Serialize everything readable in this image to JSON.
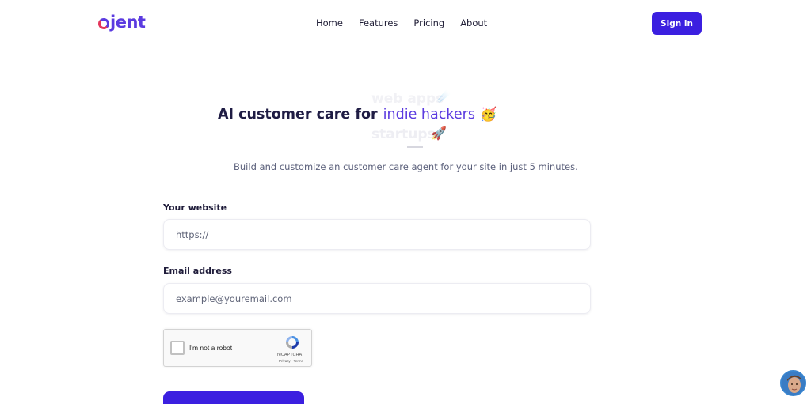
{
  "brand": {
    "logo_text": "jent"
  },
  "nav": {
    "items": [
      "Home",
      "Features",
      "Pricing",
      "About"
    ],
    "sign_in": "Sign in"
  },
  "hero": {
    "static_text": "AI customer care for",
    "rotating_current": "indie hackers",
    "rotating_prev": "web apps",
    "rotating_next": "startups",
    "emoji_current": "🥳",
    "emoji_prev": "☄️",
    "emoji_next": "🚀",
    "subtitle": "Build and customize an customer care agent for your site in just 5 minutes."
  },
  "form": {
    "website_label": "Your website",
    "website_placeholder": "https://",
    "email_label": "Email address",
    "email_placeholder": "example@youremail.com",
    "captcha_text": "I'm not a robot",
    "captcha_brand": "reCAPTCHA",
    "captcha_links": "Privacy - Terms"
  },
  "colors": {
    "accent": "#3b1fe0",
    "brand_purple": "#5b3be0",
    "brand_red": "#e4365b",
    "text_dark": "#1f1c44",
    "text_muted": "#5a5f7a"
  },
  "icons": [
    "logo-icon",
    "recaptcha-icon",
    "avatar-icon"
  ]
}
